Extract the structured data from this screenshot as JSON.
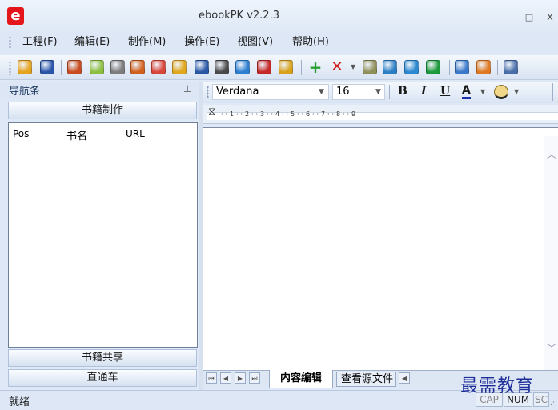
{
  "window": {
    "title": "ebookPK v2.2.3",
    "minimize": "_",
    "maximize": "□",
    "close": "x"
  },
  "menu": [
    "工程(F)",
    "编辑(E)",
    "制作(M)",
    "操作(E)",
    "视图(V)",
    "帮助(H)"
  ],
  "toolbar": {
    "icons": [
      {
        "name": "open-folder-icon",
        "color": "#e6a31d"
      },
      {
        "name": "save-icon",
        "color": "#2b55a8"
      },
      {
        "name": "magic-wand-icon",
        "color": "#c94d20"
      },
      {
        "name": "android-icon",
        "color": "#8cbf3f"
      },
      {
        "name": "apple-icon",
        "color": "#7d7d7d"
      },
      {
        "name": "java-icon",
        "color": "#d0611d"
      },
      {
        "name": "pdf-icon",
        "color": "#d9463a"
      },
      {
        "name": "help-wizard-icon",
        "color": "#e0a81c"
      },
      {
        "name": "word-icon",
        "color": "#2a57a5"
      },
      {
        "name": "document-icon",
        "color": "#4a4a4a"
      },
      {
        "name": "upload-icon",
        "color": "#2c7fd0"
      },
      {
        "name": "pen-icon",
        "color": "#c62828"
      },
      {
        "name": "coin-icon",
        "color": "#d9a21a"
      },
      {
        "name": "add-icon",
        "color": "#26a030"
      },
      {
        "name": "delete-icon",
        "color": "#d21e1e"
      },
      {
        "name": "chevron-down-icon",
        "color": "#555555"
      },
      {
        "name": "chart-icon",
        "color": "#8f8f5a"
      },
      {
        "name": "search-icon",
        "color": "#2d7fc4"
      },
      {
        "name": "settings-icon",
        "color": "#2c88d0"
      },
      {
        "name": "play-icon",
        "color": "#1d9a3c"
      },
      {
        "name": "help-icon",
        "color": "#3a78c9"
      },
      {
        "name": "home-icon",
        "color": "#e07a22"
      },
      {
        "name": "id-card-icon",
        "color": "#4a6ea8"
      }
    ]
  },
  "nav": {
    "title": "导航条",
    "pin": "ᵖ",
    "section_book_make": "书籍制作",
    "columns": [
      "Pos",
      "书名",
      "URL"
    ],
    "section_book_share": "书籍共享",
    "section_direct": "直通车"
  },
  "format": {
    "font": "Verdana",
    "size": "16",
    "bold": "B",
    "italic": "I",
    "underline": "U",
    "font_color": "A"
  },
  "ruler": {
    "text": "·  ·  1  ·  ·  2  ·  ·  3  ·  ·  4  ·  ·  5  ·  ·  6  ·  ·  7  ·  ·  8  ·  ·  9"
  },
  "tabs": {
    "active": "内容编辑",
    "inactive": "查看源文件"
  },
  "status": {
    "text": "就绪",
    "caps": "CAP",
    "num": "NUM",
    "scrl": "SC"
  },
  "watermark": "最需教育"
}
